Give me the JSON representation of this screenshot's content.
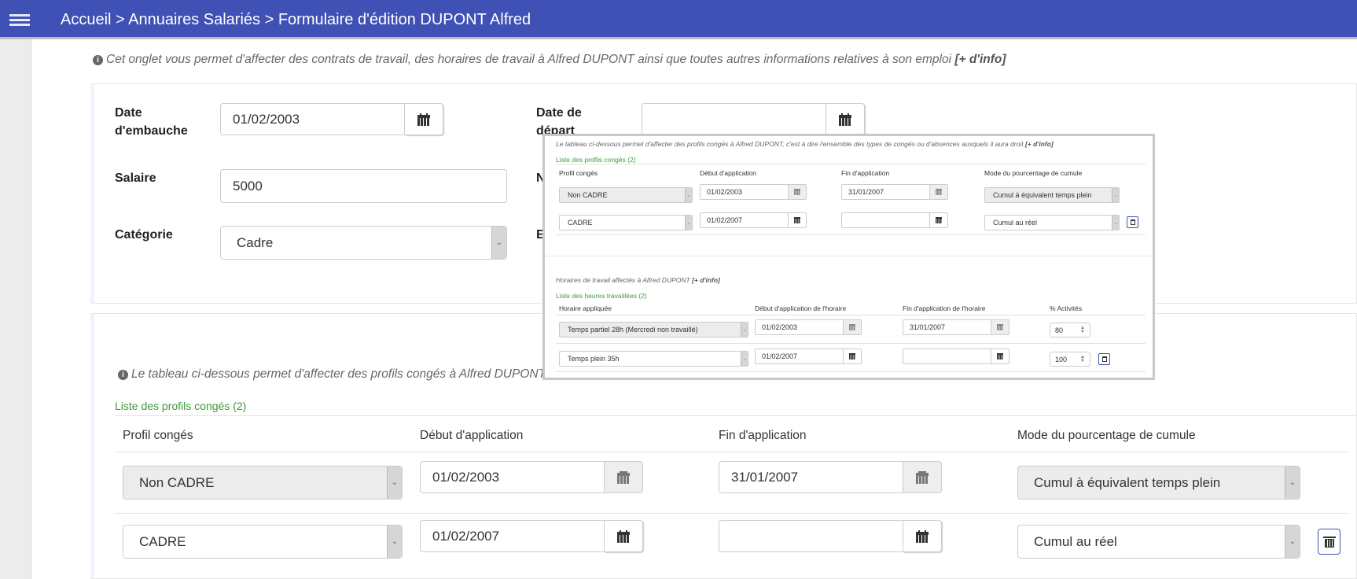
{
  "header": {
    "menu_icon": "hamburger-icon",
    "breadcrumb": "Accueil > Annuaires Salariés > Formulaire d'édition DUPONT Alfred"
  },
  "intro": {
    "text": "Cet onglet vous permet d'affecter des contrats de travail, des horaires de travail à Alfred DUPONT ainsi que toutes autres informations relatives à son emploi",
    "link": "[+ d'info]"
  },
  "form": {
    "date_embauche_label": "Date d'embauche",
    "date_embauche_value": "01/02/2003",
    "date_depart_label": "Date de départ",
    "date_depart_value": "",
    "salaire_label": "Salaire",
    "salaire_value": "5000",
    "niveau_label": "Niveau",
    "categorie_label": "Catégorie",
    "categorie_value": "Cadre",
    "echelon_label": "Echelon"
  },
  "conges": {
    "info": "Le tableau ci-dessous permet d'affecter des profils congés à Alfred DUPONT, c'est",
    "list_title": "Liste des profils congés (2)",
    "columns": [
      "Profil congés",
      "Début d'application",
      "Fin d'application",
      "Mode du pourcentage de cumule"
    ],
    "rows": [
      {
        "profil": "Non CADRE",
        "debut": "01/02/2003",
        "fin": "31/01/2007",
        "mode": "Cumul à équivalent temps plein",
        "disabled": true
      },
      {
        "profil": "CADRE",
        "debut": "01/02/2007",
        "fin": "",
        "mode": "Cumul au réel",
        "disabled": false
      }
    ]
  },
  "inset": {
    "conges_info": "Le tableau ci-dessous permet d'affecter des profils congés à Alfred DUPONT, c'est à dire l'ensemble des types de congés ou d'absences auxquels il aura droit",
    "conges_link": "[+ d'info]",
    "conges_list_title": "Liste des profils congés (2)",
    "conges_columns": [
      "Profil congés",
      "Début d'application",
      "Fin d'application",
      "Mode du pourcentage de cumule"
    ],
    "conges_rows": [
      {
        "profil": "Non CADRE",
        "debut": "01/02/2003",
        "fin": "31/01/2007",
        "mode": "Cumul à équivalent temps plein"
      },
      {
        "profil": "CADRE",
        "debut": "01/02/2007",
        "fin": "",
        "mode": "Cumul au réel"
      }
    ],
    "horaires_info": "Horaires de travail affectés à Alfred DUPONT",
    "horaires_link": "[+ d'info]",
    "horaires_list_title": "Liste des heures travaillées (2)",
    "horaires_columns": [
      "Horaire appliquée",
      "Début d'application de l'horaire",
      "Fin d'application de l'horaire",
      "% Activités"
    ],
    "horaires_rows": [
      {
        "horaire": "Temps partiel 28h (Mercredi non travaillé)",
        "debut": "01/02/2003",
        "fin": "31/01/2007",
        "activite": "80"
      },
      {
        "horaire": "Temps plein 35h",
        "debut": "01/02/2007",
        "fin": "",
        "activite": "100"
      }
    ]
  }
}
